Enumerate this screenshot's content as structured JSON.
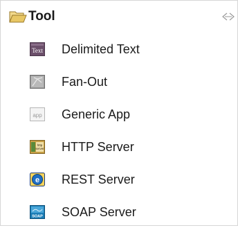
{
  "palette": {
    "title": "Tool",
    "folder_icon": "open-folder-icon",
    "collapse_icon": "collapse-arrows-icon",
    "items": [
      {
        "label": "Delimited Text",
        "icon": "delimited-text-icon",
        "icon_text": "Text"
      },
      {
        "label": "Fan-Out",
        "icon": "fan-out-icon"
      },
      {
        "label": "Generic App",
        "icon": "generic-app-icon",
        "icon_text": "app"
      },
      {
        "label": "HTTP Server",
        "icon": "http-server-icon",
        "icon_text": "http server"
      },
      {
        "label": "REST Server",
        "icon": "rest-server-icon",
        "icon_text": "e"
      },
      {
        "label": "SOAP Server",
        "icon": "soap-server-icon",
        "icon_text": "SOAP"
      }
    ]
  },
  "colors": {
    "folder": "#e8c765",
    "text_icon": "#6b4f6a",
    "rest_icon": "#1f6fc4",
    "soap_icon": "#1b7db6",
    "http_icon": "#c8a046"
  }
}
